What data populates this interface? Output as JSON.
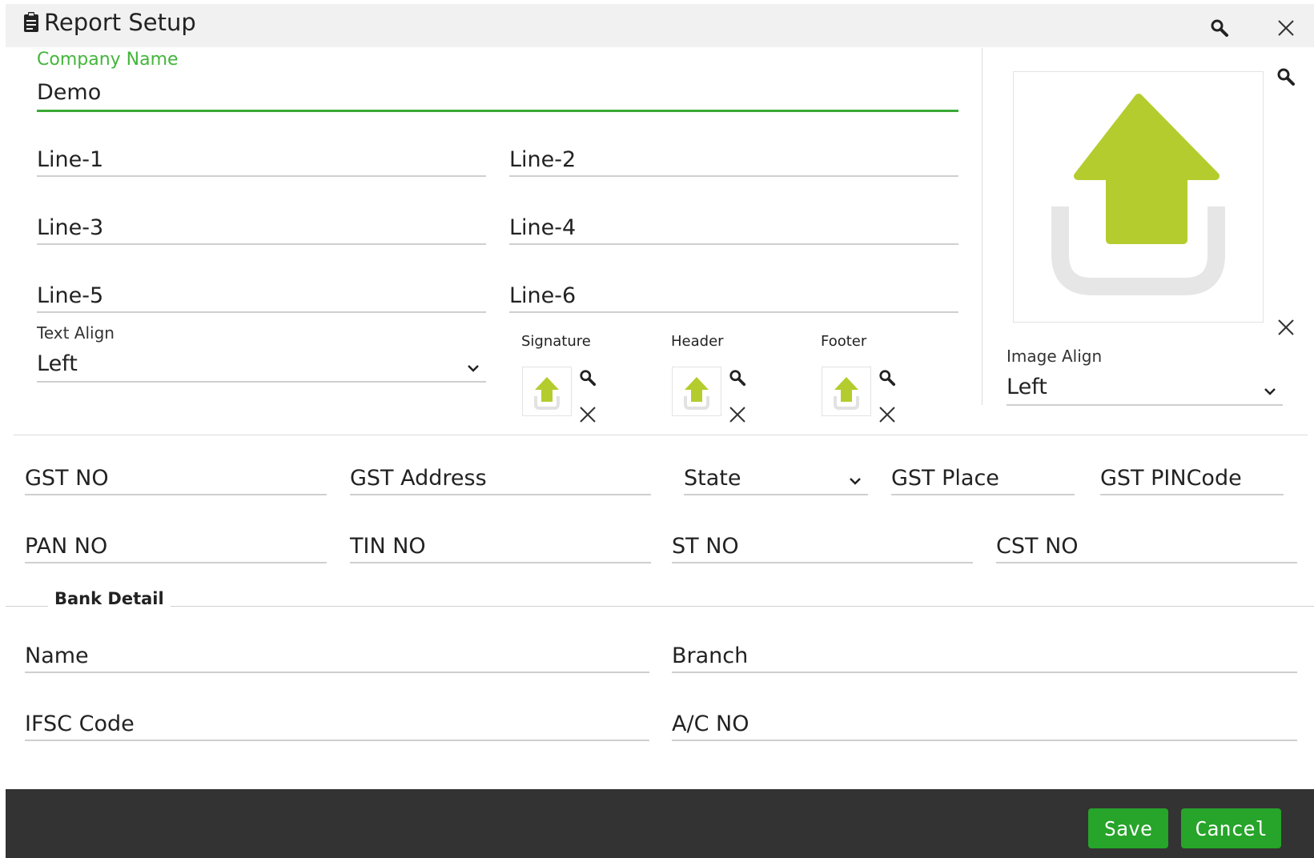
{
  "window": {
    "title": "Report Setup"
  },
  "company": {
    "label": "Company Name",
    "value": "Demo"
  },
  "address": {
    "line1": "Line-1",
    "line2": "Line-2",
    "line3": "Line-3",
    "line4": "Line-4",
    "line5": "Line-5",
    "line6": "Line-6"
  },
  "text_align": {
    "label": "Text Align",
    "value": "Left"
  },
  "image_align": {
    "label": "Image Align",
    "value": "Left"
  },
  "uploads": {
    "signature_label": "Signature",
    "header_label": "Header",
    "footer_label": "Footer"
  },
  "tax": {
    "gst_no": "GST NO",
    "gst_address": "GST Address",
    "state": "State",
    "gst_place": "GST Place",
    "gst_pincode": "GST PINCode",
    "pan_no": "PAN NO",
    "tin_no": "TIN NO",
    "st_no": "ST NO",
    "cst_no": "CST NO"
  },
  "bank": {
    "legend": "Bank Detail",
    "name": "Name",
    "branch": "Branch",
    "ifsc": "IFSC Code",
    "ac_no": "A/C NO"
  },
  "footer": {
    "save_label": "Save",
    "cancel_label": "Cancel"
  },
  "colors": {
    "accent_green": "#3aa935",
    "upload_arrow": "#b5cc2e",
    "footer_bg": "#333333",
    "button_bg": "#27a42a"
  }
}
